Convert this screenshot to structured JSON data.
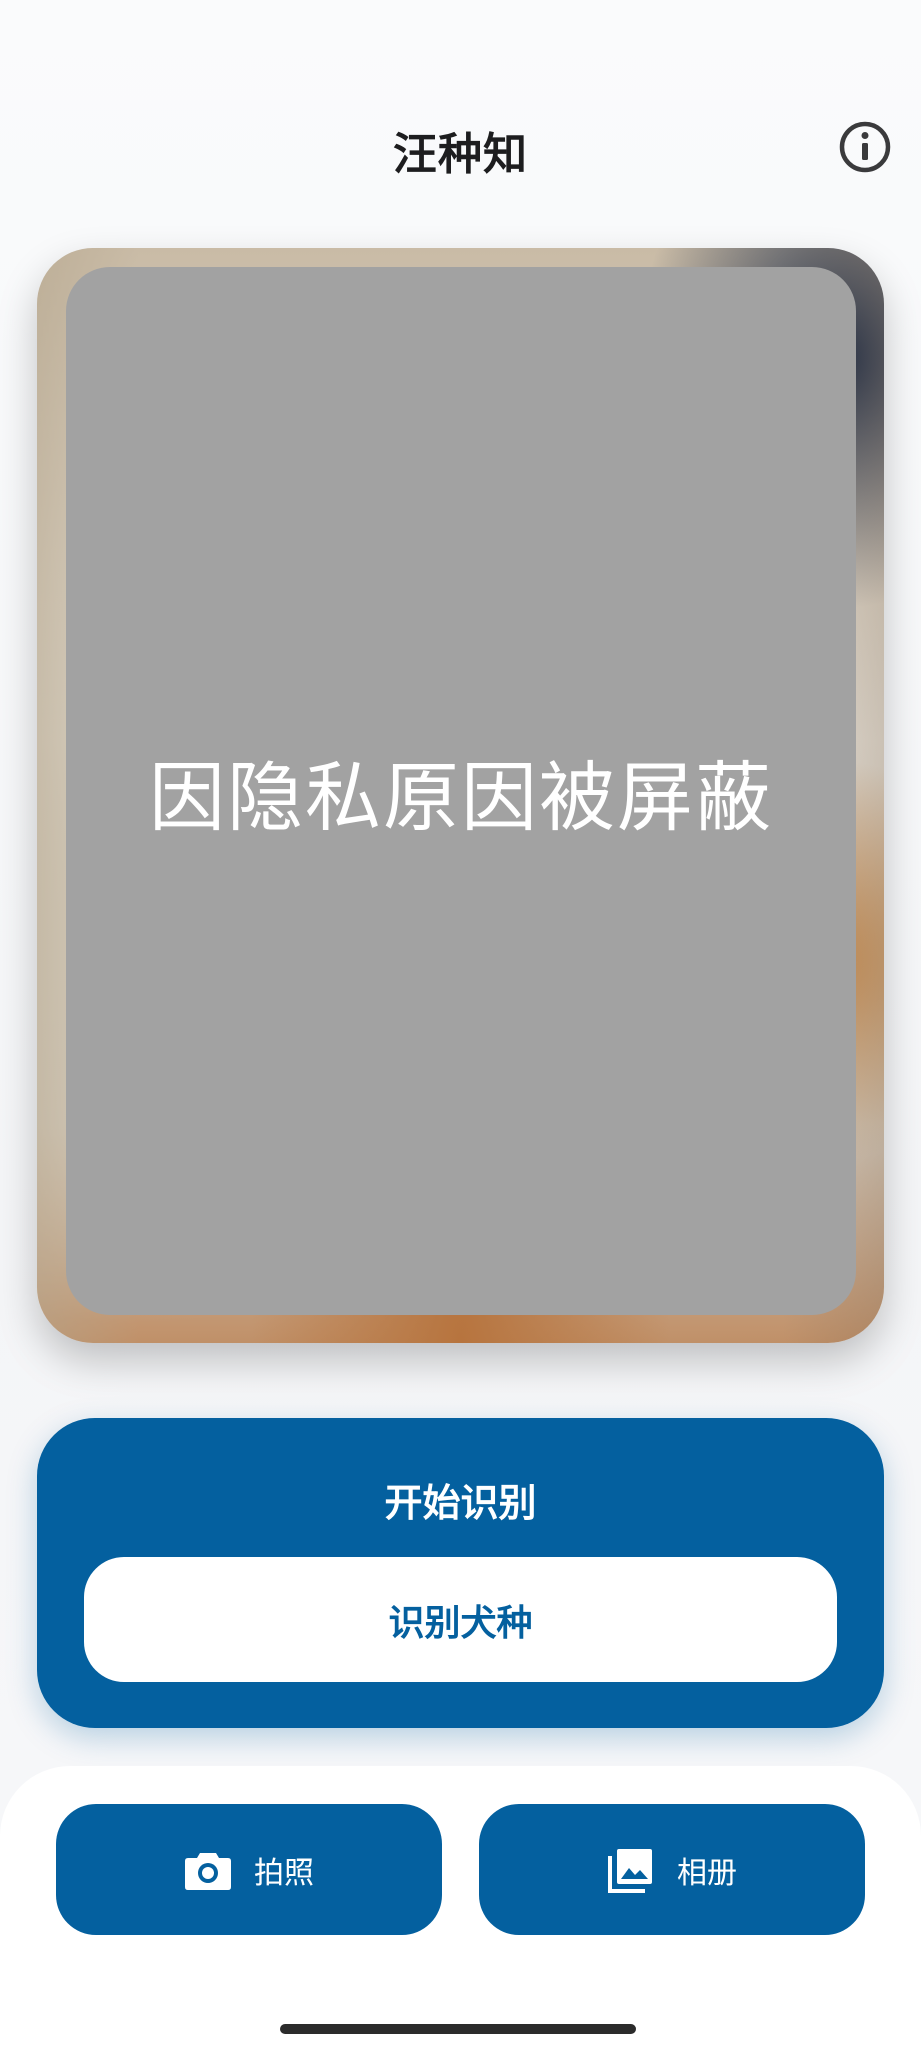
{
  "header": {
    "title": "汪种知",
    "info_icon": "info-circle-icon"
  },
  "image_card": {
    "privacy_text": "因隐私原因被屏蔽"
  },
  "recognition": {
    "title": "开始识别",
    "identify_label": "识别犬种"
  },
  "actions": {
    "camera_label": "拍照",
    "camera_icon": "camera-icon",
    "album_label": "相册",
    "album_icon": "photo-library-icon"
  },
  "colors": {
    "primary": "#04609f",
    "mask": "#a2a2a2",
    "title_text": "#1d1d1f"
  }
}
